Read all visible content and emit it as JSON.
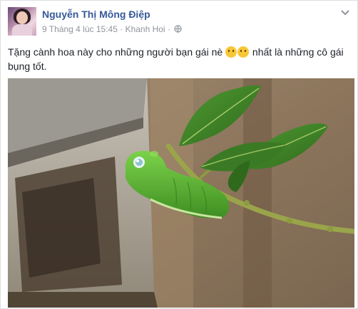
{
  "post": {
    "author_name": "Nguyễn Thị Mông Điệp",
    "timestamp": "9 Tháng 4 lúc 15:45",
    "separator": "·",
    "location": "Khanh Hoi",
    "separator2": "·",
    "privacy_icon": "globe-icon",
    "menu_icon": "chevron-down-icon",
    "text_before_emoji": "Tặng cành hoa này cho những người bạn gái nè ",
    "emojis": [
      "wink-kiss-emoji",
      "laughing-emoji"
    ],
    "text_after_emoji": " nhất là những cô gái bụng tốt.",
    "photo_icon": "caterpillar-on-branch-photo"
  }
}
